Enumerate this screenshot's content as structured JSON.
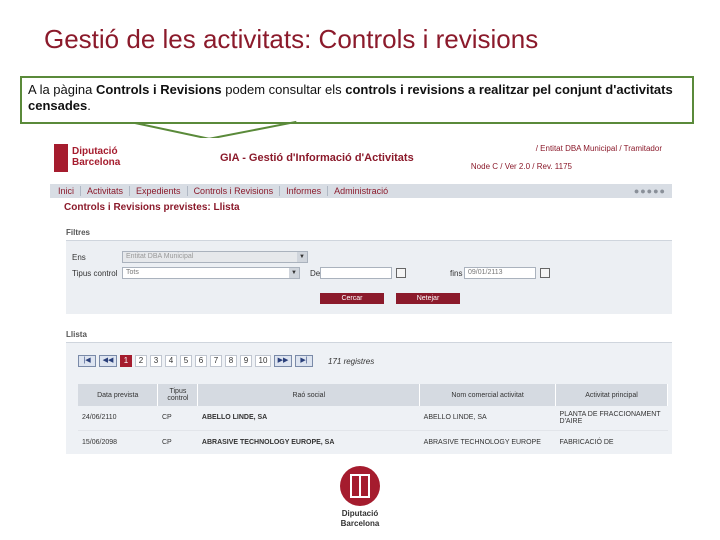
{
  "slide": {
    "title": "Gestió de les activitats: Controls i revisions",
    "callout_prefix": "A la pàgina ",
    "callout_bold1": "Controls i Revisions",
    "callout_mid": " podem consultar els ",
    "callout_bold2": "controls i revisions a realitzar pel conjunt d'activitats censades",
    "callout_suffix": "."
  },
  "app": {
    "logo_line1": "Diputació",
    "logo_line2": "Barcelona",
    "app_name": "GIA - Gestió d'Informació d'Activitats",
    "breadcrumb": "/ Entitat DBA Municipal / Tramitador",
    "node": "Node C / Ver 2.0 / Rev. 1175",
    "menu": [
      "Inici",
      "Activitats",
      "Expedients",
      "Controls i Revisions",
      "Informes",
      "Administració"
    ],
    "menu_dots": "●●●●●",
    "page_heading": "Controls i Revisions previstes: Llista"
  },
  "filters": {
    "title": "Filtres",
    "ens_label": "Ens",
    "ens_value": "Entitat DBA Municipal",
    "tipus_label": "Tipus control",
    "tipus_value": "Tots",
    "de_label": "De",
    "fins_label": "fins",
    "fins_value": "09/01/2113",
    "search_button": "Cercar",
    "clear_button": "Netejar"
  },
  "list": {
    "title": "Llista",
    "pages": [
      "1",
      "2",
      "3",
      "4",
      "5",
      "6",
      "7",
      "8",
      "9",
      "10"
    ],
    "current_page": "1",
    "record_count": "171 registres",
    "columns": [
      "Data prevista",
      "Tipus control",
      "Raó social",
      "Nom comercial activitat",
      "Activitat principal"
    ],
    "rows": [
      [
        "24/06/2110",
        "CP",
        "ABELLO LINDE, SA",
        "ABELLO LINDE, SA",
        "PLANTA DE FRACCIONAMENT D'AIRE"
      ],
      [
        "15/06/2098",
        "CP",
        "ABRASIVE TECHNOLOGY EUROPE, SA",
        "ABRASIVE TECHNOLOGY EUROPE",
        "FABRICACIÓ DE"
      ]
    ]
  },
  "footer_logo": {
    "line1": "Diputació",
    "line2": "Barcelona"
  }
}
